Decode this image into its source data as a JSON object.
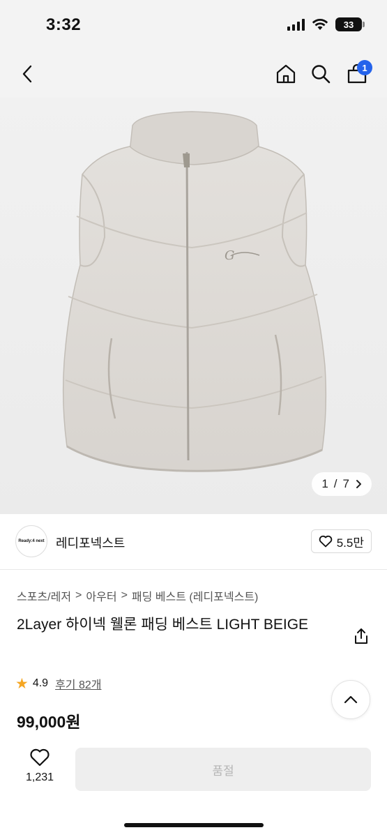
{
  "status_bar": {
    "time": "3:32",
    "battery": "33",
    "icons": [
      "signal-icon",
      "wifi-icon",
      "battery-icon"
    ]
  },
  "nav": {
    "icons": [
      "back-arrow-icon",
      "home-icon",
      "search-icon",
      "cart-icon"
    ],
    "cart_badge": "1"
  },
  "gallery": {
    "current": "1",
    "separator": "/",
    "total": "7",
    "next_icon": "chevron-right-icon"
  },
  "brand": {
    "logo_text": "Ready:4 next",
    "name": "레디포넥스트",
    "like_count": "5.5만",
    "like_icon": "heart-outline-icon"
  },
  "breadcrumb": {
    "items": [
      "스포츠/레저",
      "아우터",
      "패딩 베스트 (레디포넥스트)"
    ],
    "separator": ">"
  },
  "product": {
    "title": "2Layer 하이넥 웰론 패딩 베스트 LIGHT BEIGE",
    "rating": "4.9",
    "reviews": "후기 82개",
    "price": "99,000원",
    "share_icon": "share-icon"
  },
  "bottom_bar": {
    "wish_count": "1,231",
    "wish_icon": "heart-outline-icon",
    "action_label": "품절"
  },
  "colors": {
    "accent_badge": "#2563eb",
    "star": "#f5a623",
    "disabled_bg": "#eeeeee",
    "disabled_text": "#b5b5b5",
    "header_bg": "#f3f3f3"
  }
}
